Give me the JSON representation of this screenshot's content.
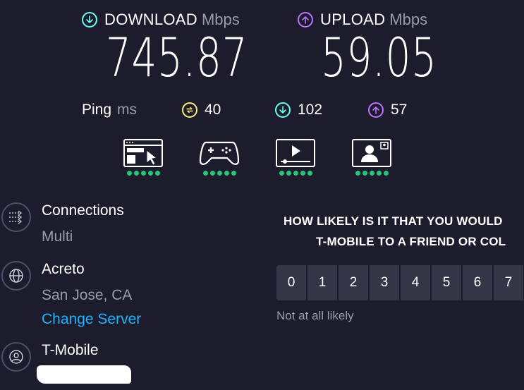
{
  "download": {
    "label": "DOWNLOAD",
    "unit": "Mbps",
    "value": "745.87",
    "icon": "arrow-down-circle-icon",
    "color": "#6afff3"
  },
  "upload": {
    "label": "UPLOAD",
    "unit": "Mbps",
    "value": "59.05",
    "icon": "arrow-up-circle-icon",
    "color": "#bf71ff"
  },
  "ping": {
    "label": "Ping",
    "unit": "ms",
    "idle": {
      "value": "40",
      "icon": "ping-idle-icon",
      "color": "#fbee74"
    },
    "download": {
      "value": "102",
      "icon": "arrow-down-circle-icon",
      "color": "#6afff3"
    },
    "upload": {
      "value": "57",
      "icon": "arrow-up-circle-icon",
      "color": "#bf71ff"
    }
  },
  "experiences": [
    {
      "icon": "web-browsing-icon",
      "rating": 5
    },
    {
      "icon": "gaming-icon",
      "rating": 5
    },
    {
      "icon": "video-streaming-icon",
      "rating": 5
    },
    {
      "icon": "video-chat-icon",
      "rating": 5
    }
  ],
  "connections": {
    "title": "Connections",
    "value": "Multi",
    "icon": "connections-icon"
  },
  "server": {
    "name": "Acreto",
    "location": "San Jose, CA",
    "change_label": "Change Server",
    "icon": "globe-icon"
  },
  "provider": {
    "name": "T-Mobile",
    "icon": "user-icon"
  },
  "survey": {
    "question_line1": "HOW LIKELY IS IT THAT YOU WOULD",
    "question_line2": "T-MOBILE TO A FRIEND OR COL",
    "options": [
      "0",
      "1",
      "2",
      "3",
      "4",
      "5",
      "6",
      "7"
    ],
    "low_label": "Not at all likely"
  },
  "colors": {
    "background": "#1c1c2d",
    "rating_dot": "#26c77d",
    "link": "#1fb3ff"
  }
}
